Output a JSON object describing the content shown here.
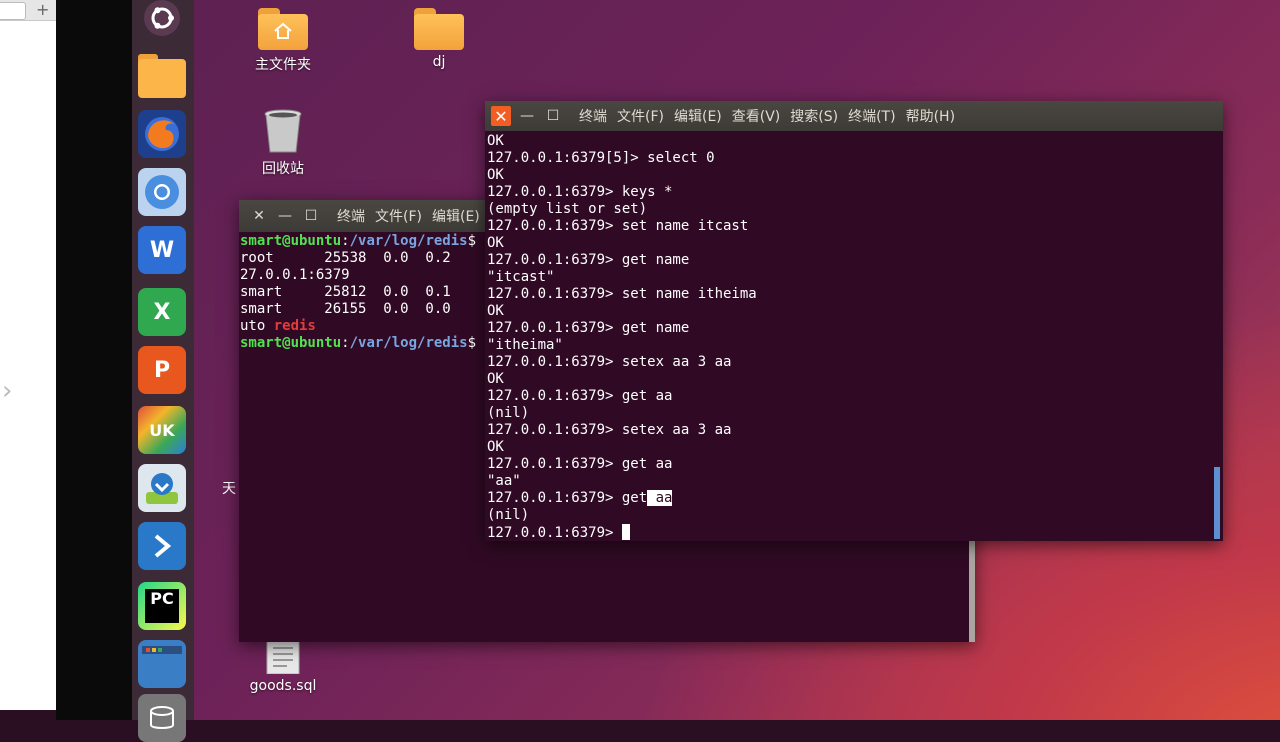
{
  "browser": {
    "new_tab_label": "+",
    "side_arrow": "›"
  },
  "launcher": {
    "items": [
      {
        "name": "ubuntu-dash",
        "color": "#3c2a37"
      },
      {
        "name": "files",
        "color": "#f5a623"
      },
      {
        "name": "firefox",
        "color": "#e8611a"
      },
      {
        "name": "chromium",
        "color": "#4a8ee0"
      },
      {
        "name": "wps-writer",
        "label": "W",
        "color": "#2e6fd6"
      },
      {
        "name": "wps-spreadsheets",
        "label": "X",
        "color": "#2fa84f"
      },
      {
        "name": "wps-presentation",
        "label": "P",
        "color": "#e8571d"
      },
      {
        "name": "ubuntu-kylin-software",
        "label": "UK",
        "color": "#2b7fd8"
      },
      {
        "name": "backup-tool",
        "color": "#8fc63e"
      },
      {
        "name": "terminal",
        "color": "#2a78c8"
      },
      {
        "name": "pycharm",
        "label": "PC",
        "color": "#21d789"
      },
      {
        "name": "workspace",
        "color": "#3a7fc6"
      },
      {
        "name": "database",
        "color": "#888888"
      }
    ]
  },
  "desktop": {
    "icons": [
      {
        "name": "home-folder",
        "label": "主文件夹"
      },
      {
        "name": "dj-folder",
        "label": "dj"
      },
      {
        "name": "trash",
        "label": "回收站"
      },
      {
        "name": "goods-sql",
        "label": "goods.sql"
      }
    ],
    "stray_text": "天"
  },
  "terminal_back": {
    "close_label": "✕",
    "minimize_label": "—",
    "maximize_label": "☐",
    "menus": [
      "终端",
      "文件(F)",
      "编辑(E)"
    ],
    "lines": [
      [
        {
          "t": "smart@ubuntu",
          "c": "green"
        },
        {
          "t": ":",
          "c": ""
        },
        {
          "t": "/var/log/redis",
          "c": "blue"
        },
        {
          "t": "$",
          "c": ""
        }
      ],
      [
        {
          "t": "root      25538  0.0  0.2  ",
          "c": ""
        }
      ],
      [
        {
          "t": "27.0.0.1:6379",
          "c": ""
        }
      ],
      [
        {
          "t": "smart     25812  0.0  0.1  ",
          "c": ""
        }
      ],
      [
        {
          "t": "smart     26155  0.0  0.0  ",
          "c": ""
        }
      ],
      [
        {
          "t": "uto ",
          "c": ""
        },
        {
          "t": "redis",
          "c": "red"
        }
      ],
      [
        {
          "t": "smart@ubuntu",
          "c": "green"
        },
        {
          "t": ":",
          "c": ""
        },
        {
          "t": "/var/log/redis",
          "c": "blue"
        },
        {
          "t": "$",
          "c": ""
        }
      ]
    ]
  },
  "terminal_front": {
    "close_label": "✕",
    "minimize_label": "—",
    "maximize_label": "☐",
    "menus": [
      "终端",
      "文件(F)",
      "编辑(E)",
      "查看(V)",
      "搜索(S)",
      "终端(T)",
      "帮助(H)"
    ],
    "lines": [
      "OK",
      "127.0.0.1:6379[5]> select 0",
      "OK",
      "127.0.0.1:6379> keys *",
      "(empty list or set)",
      "127.0.0.1:6379> set name itcast",
      "OK",
      "127.0.0.1:6379> get name",
      "\"itcast\"",
      "127.0.0.1:6379> set name itheima",
      "OK",
      "127.0.0.1:6379> get name",
      "\"itheima\"",
      "127.0.0.1:6379> setex aa 3 aa",
      "OK",
      "127.0.0.1:6379> get aa",
      "(nil)",
      "127.0.0.1:6379> setex aa 3 aa",
      "OK",
      "127.0.0.1:6379> get aa",
      "\"aa\""
    ],
    "last_cmd_prefix": "127.0.0.1:6379> get",
    "last_cmd_selected": " aa",
    "result": "(nil)",
    "prompt": "127.0.0.1:6379> "
  }
}
